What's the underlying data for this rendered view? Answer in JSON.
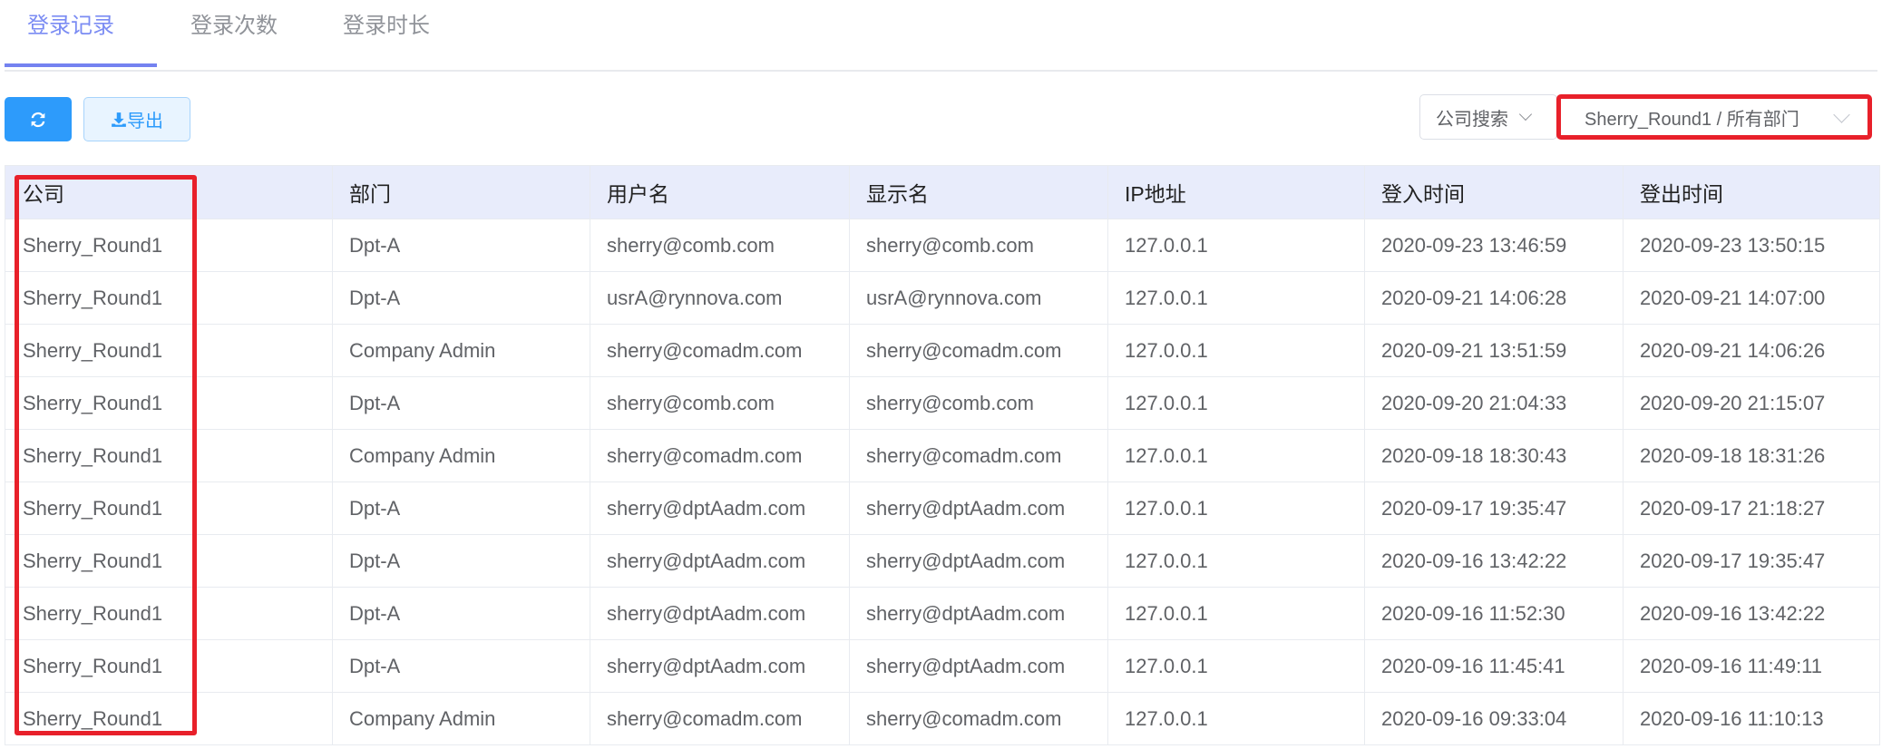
{
  "tabs": [
    {
      "label": "登录记录",
      "active": true
    },
    {
      "label": "登录次数"
    },
    {
      "label": "登录时长"
    }
  ],
  "toolbar": {
    "refresh_icon": "refresh-icon",
    "export_icon": "download-icon",
    "export_label": "导出"
  },
  "filters": {
    "company_search": "公司搜索",
    "scope": "Sherry_Round1 / 所有部门"
  },
  "colors": {
    "accent": "#2d9bfb",
    "tab_active": "#7b8cf3",
    "highlight": "#e8202a",
    "header_bg": "#e8ecfb"
  },
  "table": {
    "columns": [
      "公司",
      "部门",
      "用户名",
      "显示名",
      "IP地址",
      "登入时间",
      "登出时间"
    ],
    "rows": [
      [
        "Sherry_Round1",
        "Dpt-A",
        "sherry@comb.com",
        "sherry@comb.com",
        "127.0.0.1",
        "2020-09-23 13:46:59",
        "2020-09-23 13:50:15"
      ],
      [
        "Sherry_Round1",
        "Dpt-A",
        "usrA@rynnova.com",
        "usrA@rynnova.com",
        "127.0.0.1",
        "2020-09-21 14:06:28",
        "2020-09-21 14:07:00"
      ],
      [
        "Sherry_Round1",
        "Company Admin",
        "sherry@comadm.com",
        "sherry@comadm.com",
        "127.0.0.1",
        "2020-09-21 13:51:59",
        "2020-09-21 14:06:26"
      ],
      [
        "Sherry_Round1",
        "Dpt-A",
        "sherry@comb.com",
        "sherry@comb.com",
        "127.0.0.1",
        "2020-09-20 21:04:33",
        "2020-09-20 21:15:07"
      ],
      [
        "Sherry_Round1",
        "Company Admin",
        "sherry@comadm.com",
        "sherry@comadm.com",
        "127.0.0.1",
        "2020-09-18 18:30:43",
        "2020-09-18 18:31:26"
      ],
      [
        "Sherry_Round1",
        "Dpt-A",
        "sherry@dptAadm.com",
        "sherry@dptAadm.com",
        "127.0.0.1",
        "2020-09-17 19:35:47",
        "2020-09-17 21:18:27"
      ],
      [
        "Sherry_Round1",
        "Dpt-A",
        "sherry@dptAadm.com",
        "sherry@dptAadm.com",
        "127.0.0.1",
        "2020-09-16 13:42:22",
        "2020-09-17 19:35:47"
      ],
      [
        "Sherry_Round1",
        "Dpt-A",
        "sherry@dptAadm.com",
        "sherry@dptAadm.com",
        "127.0.0.1",
        "2020-09-16 11:52:30",
        "2020-09-16 13:42:22"
      ],
      [
        "Sherry_Round1",
        "Dpt-A",
        "sherry@dptAadm.com",
        "sherry@dptAadm.com",
        "127.0.0.1",
        "2020-09-16 11:45:41",
        "2020-09-16 11:49:11"
      ],
      [
        "Sherry_Round1",
        "Company Admin",
        "sherry@comadm.com",
        "sherry@comadm.com",
        "127.0.0.1",
        "2020-09-16 09:33:04",
        "2020-09-16 11:10:13"
      ]
    ]
  }
}
